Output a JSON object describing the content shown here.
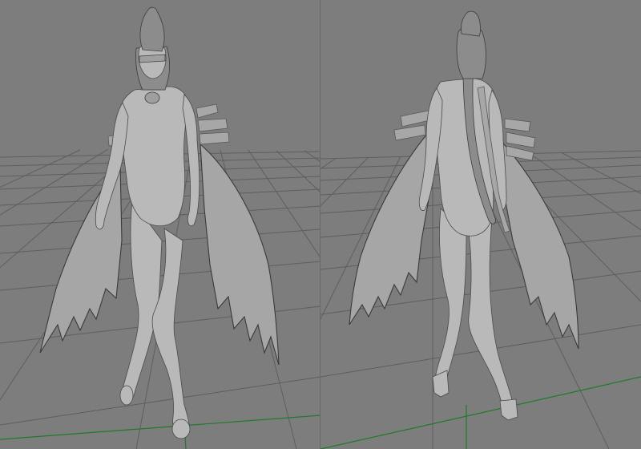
{
  "scene": {
    "layout": "two-viewports",
    "background_color": "#7f7f7f",
    "grid_color": "#5e5e5e",
    "axis_color": "#1f7a2b",
    "model_color": "#b9b9b9",
    "viewports": [
      {
        "id": "front",
        "label": ""
      },
      {
        "id": "back",
        "label": ""
      }
    ]
  }
}
